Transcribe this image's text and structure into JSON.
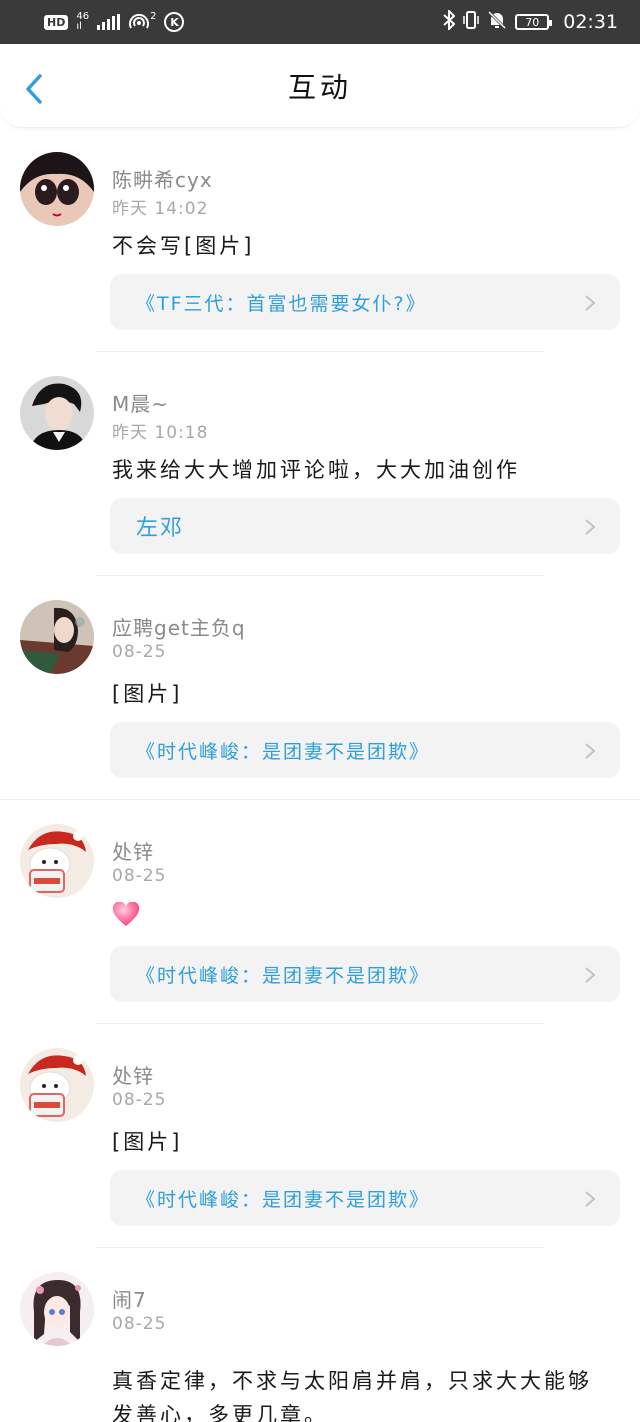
{
  "status_bar": {
    "hd": "HD",
    "network": "46",
    "network_sub": "ıl",
    "hotspot_count": "2",
    "k_icon": "K",
    "battery": "70",
    "time": "02:31"
  },
  "header": {
    "title": "互动"
  },
  "comments": [
    {
      "user": "陈畊希cyx",
      "time": "昨天 14:02",
      "text": "不会写[图片]",
      "work": "《TF三代：首富也需要女仆?》"
    },
    {
      "user": "M晨~",
      "time": "昨天 10:18",
      "text": "我来给大大增加评论啦，大大加油创作",
      "work": "左邓"
    },
    {
      "user": "应聘get主负q",
      "time": "08-25",
      "text": "[图片]",
      "work": "《时代峰峻：是团妻不是团欺》"
    },
    {
      "user": "处锌",
      "time": "08-25",
      "text": "",
      "work": "《时代峰峻：是团妻不是团欺》"
    },
    {
      "user": "处锌",
      "time": "08-25",
      "text": "[图片]",
      "work": "《时代峰峻：是团妻不是团欺》"
    },
    {
      "user": "闹7",
      "time": "08-25",
      "text": "真香定律，不求与太阳肩并肩，只求大大能够发善心，多更几章。"
    }
  ],
  "colors": {
    "accent": "#2d9fde",
    "card_bg": "#f3f3f3",
    "status_bar": "#3a3a3a"
  }
}
